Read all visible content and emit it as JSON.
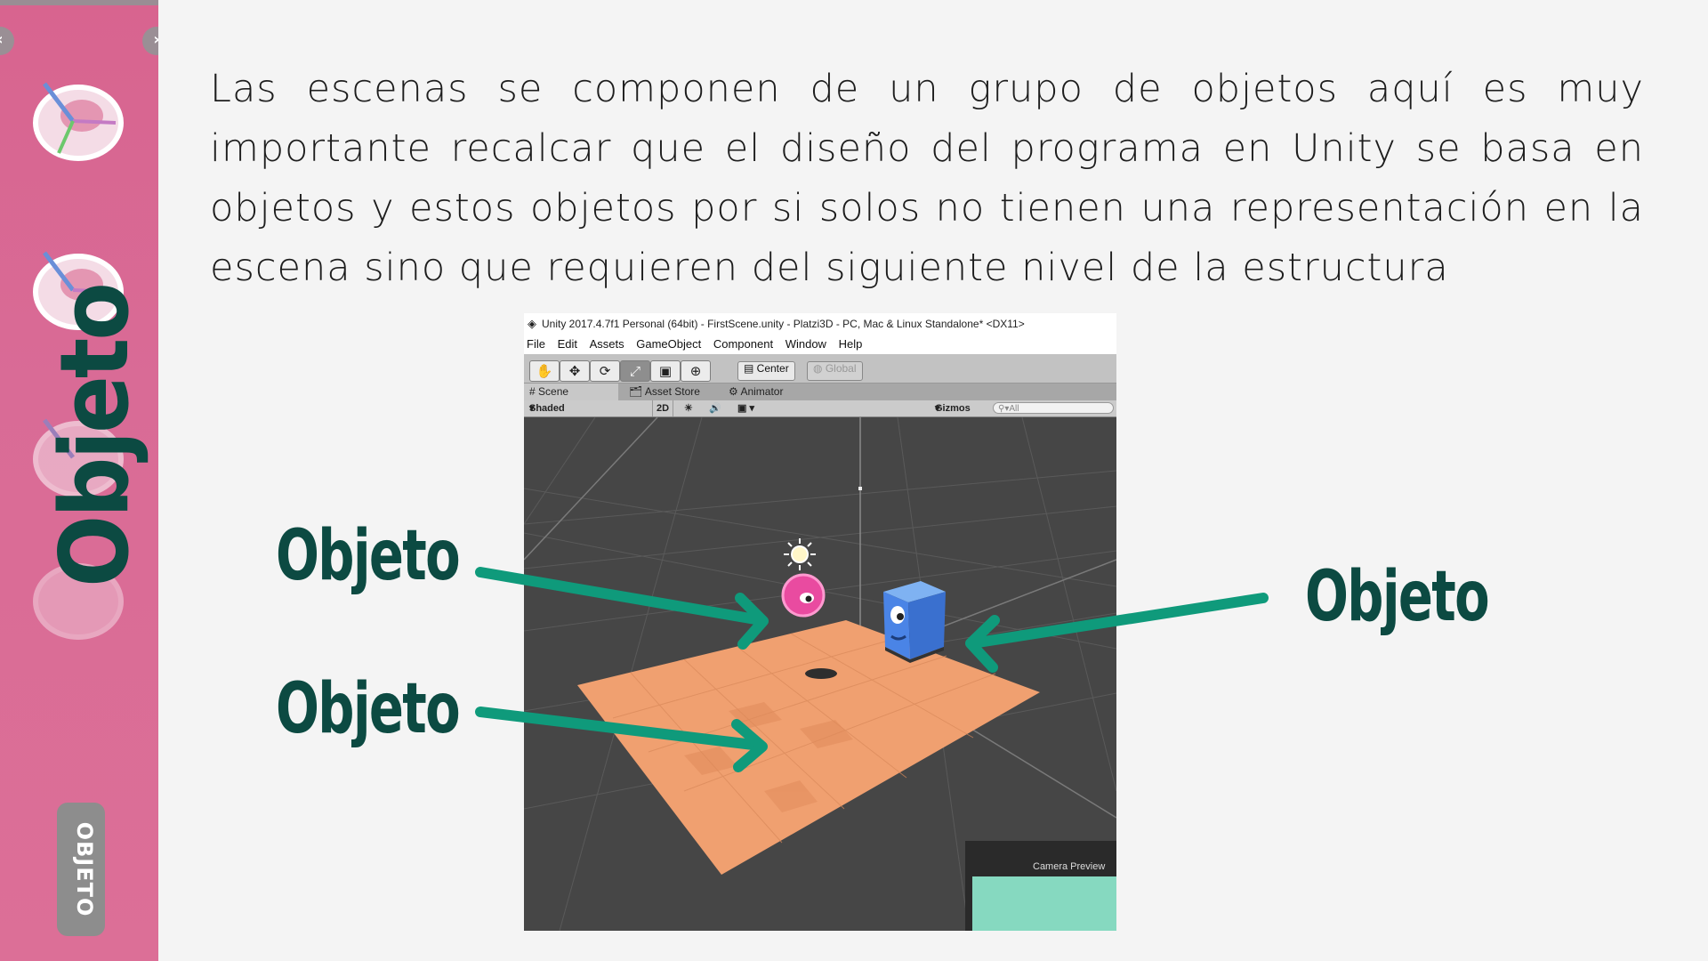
{
  "sidebar": {
    "title": "Objeto",
    "tag": "OBJETO",
    "accent_color": "#d9678f",
    "title_color": "#0c4a42",
    "decorations": [
      "transform-gizmo-icon",
      "transform-gizmo-icon",
      "transform-gizmo-icon"
    ]
  },
  "content": {
    "paragraph": "Las escenas se componen de un grupo de objetos aquí es muy importante recalcar que el diseño del programa en Unity se basa en objetos y estos objetos por si solos no tienen una representación en la escena sino que requieren del siguiente nivel de la estructura"
  },
  "unity": {
    "title": "Unity 2017.4.7f1 Personal (64bit) - FirstScene.unity - Platzi3D - PC, Mac & Linux Standalone* <DX11>",
    "menu": [
      "File",
      "Edit",
      "Assets",
      "GameObject",
      "Component",
      "Window",
      "Help"
    ],
    "tools": [
      "hand-tool-icon",
      "move-tool-icon",
      "rotate-tool-icon",
      "scale-tool-icon",
      "rect-tool-icon",
      "transform-tool-icon"
    ],
    "pivot_label": "Center",
    "space_label": "Global",
    "tabs": [
      "Scene",
      "Asset Store",
      "Animator"
    ],
    "shading": "Shaded",
    "mode_2d": "2D",
    "gizmos": "Gizmos",
    "search_placeholder": "All",
    "camera_preview": "Camera Preview",
    "colors": {
      "floor": "#f0a070",
      "sphere": "#e94ba0",
      "cube": "#4a84e6",
      "background": "#464646"
    }
  },
  "callouts": {
    "top_left": "Objeto",
    "bottom_left": "Objeto",
    "right": "Objeto",
    "arrow_color": "#0f9a7b"
  }
}
